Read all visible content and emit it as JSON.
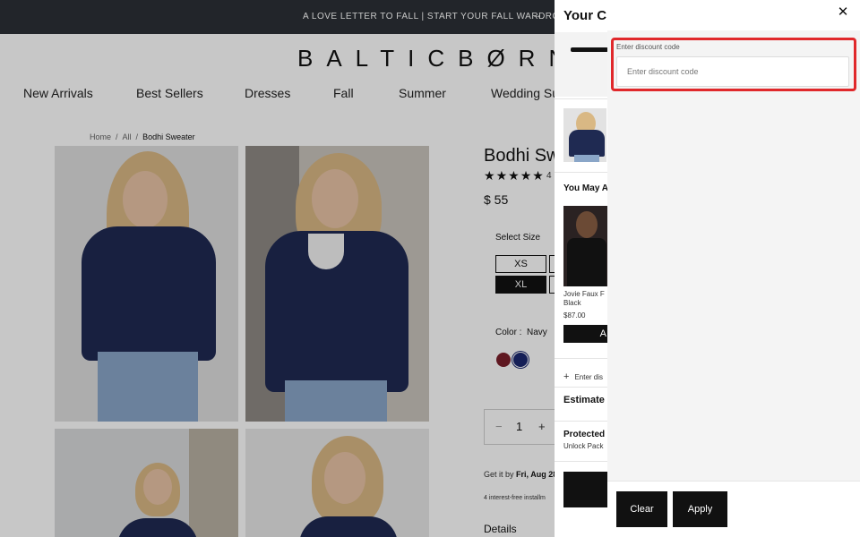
{
  "announcement": {
    "text": "A LOVE LETTER TO FALL | START YOUR FALL WARDROBE",
    "arrow_icon": "arrow-right-icon"
  },
  "brand": {
    "logo": "BALTICBØRN"
  },
  "nav": {
    "items": [
      "New Arrivals",
      "Best Sellers",
      "Dresses",
      "Fall",
      "Summer",
      "Wedding Su"
    ]
  },
  "breadcrumb": {
    "items": [
      "Home",
      "All",
      "Bodhi Sweater"
    ]
  },
  "product": {
    "title": "Bodhi Sw",
    "rating_stars": 5,
    "review_count_partial": "4",
    "price": "$ 55",
    "select_size_label": "Select Size",
    "sizes_visible": [
      "XS",
      "XL"
    ],
    "selected_size": "XL",
    "color_label": "Color :",
    "color_value": "Navy",
    "swatches": [
      "#7a1f2b",
      "#1b2870"
    ],
    "quantity": "1",
    "qty_minus": "−",
    "qty_plus": "+",
    "delivery_prefix": "Get it by",
    "delivery_date": "Fri, Aug 28",
    "installments": "4 interest-free installm",
    "details_label": "Details"
  },
  "cart": {
    "title": "Your C",
    "close_icon": "close-icon",
    "progress": 0.7,
    "you_may_also_like": "You May A",
    "recommendation": {
      "name_line1": "Jovie Faux F",
      "name_line2": "Black",
      "price": "$87.00",
      "add_label": "A"
    },
    "discount_toggle": "Enter dis",
    "estimate_label": "Estimate",
    "protected_label": "Protected",
    "unlock_text": "Unlock Pack"
  },
  "discount": {
    "label": "Enter discount code",
    "placeholder": "Enter discount code",
    "value": "",
    "clear_label": "Clear",
    "apply_label": "Apply"
  },
  "colors": {
    "accent_highlight": "#e0282b",
    "announcement_bg": "#2c3036",
    "button_bg": "#111111"
  }
}
